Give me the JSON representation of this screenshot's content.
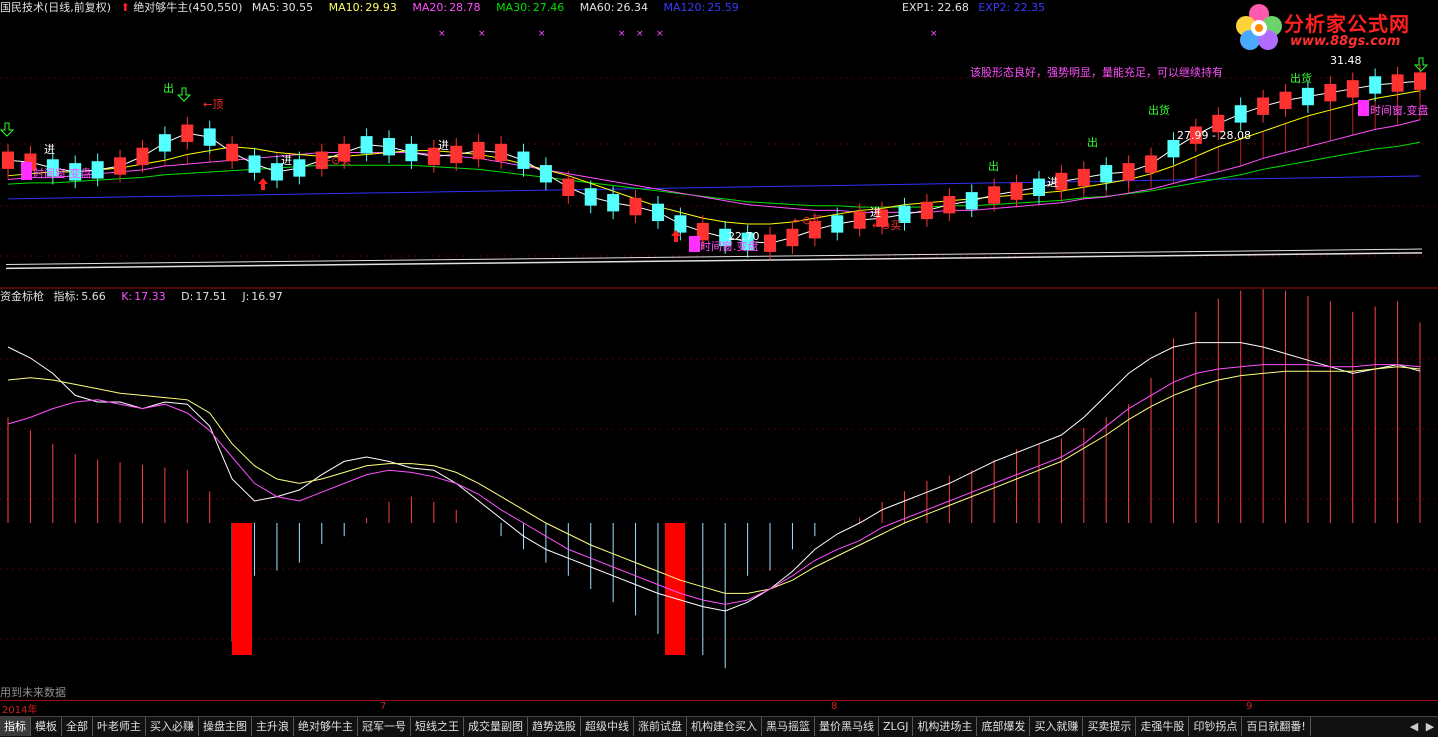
{
  "header": {
    "stock": "国民技术(日线,前复权)",
    "indicator_name": "绝对够牛主(450,550)",
    "ma5_label": "MA5:",
    "ma5": "30.55",
    "ma10_label": "MA10:",
    "ma10": "29.93",
    "ma20_label": "MA20:",
    "ma20": "28.78",
    "ma30_label": "MA30:",
    "ma30": "27.46",
    "ma60_label": "MA60:",
    "ma60": "26.34",
    "ma120_label": "MA120:",
    "ma120": "25.59",
    "exp1_label": "EXP1:",
    "exp1": "22.68",
    "exp2_label": "EXP2:",
    "exp2": "22.35"
  },
  "logo": {
    "brand": "分析家公式网",
    "url": "www.88gs.com"
  },
  "main_annotations": {
    "comment": "该股形态良好，强势明显，量能充足，可以继续持有",
    "top": "←顶",
    "jin": "进",
    "chu": "出",
    "chu_huo": "出货",
    "buy": "←⊙买",
    "price_low": "22.70",
    "price_high": "31.48",
    "range": "27.99 - 28.08",
    "time_window": "时间窗.变盘"
  },
  "sub_header": {
    "title": "资金标枪",
    "indicator_label": "指标:",
    "indicator": "5.66",
    "k_label": "K:",
    "k": "17.33",
    "d_label": "D:",
    "d": "17.51",
    "j_label": "J:",
    "j": "16.97"
  },
  "note": "用到未来数据",
  "date_axis": {
    "year": "2014年",
    "m7": "7",
    "m8": "8",
    "m9": "9"
  },
  "tabs": [
    "指标",
    "模板",
    "全部",
    "叶老师主",
    "买入必赚",
    "操盘主图",
    "主升浪",
    "绝对够牛主",
    "冠军一号",
    "短线之王",
    "成交量副图",
    "趋势选股",
    "超级中线",
    "涨前试盘",
    "机构建仓买入",
    "黑马摇篮",
    "量价黑马线",
    "ZLGJ",
    "机构进场主",
    "底部爆发",
    "买入就赚",
    "买卖提示",
    "走强牛股",
    "印钞拐点",
    "百日就翻番!"
  ],
  "tab_arrows": [
    "◀",
    "▶"
  ],
  "colors": {
    "up": "#ff3232",
    "down": "#54ffff",
    "ma5": "#ffffff",
    "ma10": "#ffff00",
    "ma20": "#ff50ff",
    "ma30": "#00e000",
    "ma60": "#cccccc",
    "ma120": "#3030ff",
    "k": "#ffffff",
    "d": "#ffff80",
    "j": "#ff50ff",
    "signal": "#ff00ff"
  },
  "chart_data": [
    {
      "type": "candlestick",
      "series": [
        {
          "name": "MA5",
          "values": [
            27.6,
            27.5,
            27.2,
            27.0,
            27.1,
            27.3,
            27.8,
            28.5,
            29.0,
            28.8,
            28.0,
            27.4,
            27.0,
            27.2,
            27.6,
            28.0,
            28.4,
            28.3,
            28.0,
            27.8,
            27.9,
            28.1,
            28.0,
            27.6,
            26.9,
            26.2,
            25.7,
            25.4,
            25.2,
            24.9,
            24.3,
            23.9,
            23.6,
            23.4,
            23.3,
            23.6,
            24.0,
            24.3,
            24.5,
            24.6,
            24.8,
            25.0,
            25.3,
            25.5,
            25.8,
            26.0,
            26.2,
            26.5,
            26.7,
            26.9,
            27.0,
            27.4,
            28.2,
            28.9,
            29.5,
            30.0,
            30.4,
            30.7,
            30.9,
            31.1,
            31.3,
            31.5,
            31.6,
            31.7
          ]
        },
        {
          "name": "MA10",
          "values": [
            26.8,
            26.9,
            27.0,
            27.0,
            27.1,
            27.2,
            27.4,
            27.6,
            27.9,
            28.1,
            28.3,
            28.2,
            28.0,
            27.9,
            27.8,
            27.8,
            27.9,
            28.0,
            28.1,
            28.1,
            28.0,
            27.9,
            27.7,
            27.4,
            27.1,
            26.8,
            26.4,
            26.0,
            25.6,
            25.2,
            24.9,
            24.6,
            24.4,
            24.3,
            24.3,
            24.4,
            24.6,
            24.8,
            25.0,
            25.1,
            25.3,
            25.4,
            25.5,
            25.6,
            25.7,
            25.8,
            25.9,
            26.0,
            26.2,
            26.4,
            26.6,
            26.9,
            27.3,
            27.8,
            28.3,
            28.7,
            29.1,
            29.5,
            29.9,
            30.2,
            30.5,
            30.8,
            31.0,
            31.2
          ]
        },
        {
          "name": "MA20",
          "values": [
            26.6,
            26.7,
            26.7,
            26.8,
            26.9,
            27.0,
            27.1,
            27.3,
            27.4,
            27.5,
            27.6,
            27.7,
            27.8,
            27.9,
            28.0,
            28.0,
            28.0,
            28.0,
            28.0,
            27.9,
            27.8,
            27.7,
            27.5,
            27.3,
            27.1,
            26.9,
            26.7,
            26.5,
            26.3,
            26.1,
            25.9,
            25.7,
            25.5,
            25.3,
            25.2,
            25.1,
            25.0,
            25.0,
            24.9,
            24.9,
            24.9,
            24.9,
            25.0,
            25.0,
            25.1,
            25.2,
            25.3,
            25.4,
            25.6,
            25.7,
            25.9,
            26.1,
            26.4,
            26.7,
            27.0,
            27.3,
            27.7,
            28.0,
            28.3,
            28.6,
            28.9,
            29.2,
            29.4,
            29.7
          ]
        }
      ]
    },
    {
      "type": "line",
      "series": [
        {
          "name": "K",
          "values": [
            80,
            75,
            68,
            58,
            55,
            55,
            52,
            55,
            54,
            44,
            20,
            10,
            12,
            15,
            22,
            28,
            30,
            28,
            25,
            24,
            18,
            10,
            2,
            -6,
            -12,
            -16,
            -20,
            -24,
            -28,
            -32,
            -35,
            -38,
            -40,
            -36,
            -30,
            -22,
            -12,
            -5,
            0,
            6,
            10,
            14,
            18,
            23,
            28,
            32,
            36,
            40,
            48,
            58,
            68,
            75,
            80,
            82,
            82,
            82,
            80,
            77,
            74,
            71,
            68,
            70,
            72,
            69
          ]
        },
        {
          "name": "D",
          "values": [
            65,
            66,
            65,
            63,
            61,
            59,
            58,
            57,
            56,
            50,
            36,
            26,
            20,
            18,
            20,
            23,
            26,
            27,
            27,
            26,
            23,
            18,
            12,
            6,
            0,
            -5,
            -10,
            -14,
            -18,
            -22,
            -26,
            -29,
            -32,
            -32,
            -30,
            -26,
            -20,
            -15,
            -10,
            -5,
            0,
            4,
            8,
            12,
            16,
            20,
            24,
            28,
            34,
            40,
            47,
            53,
            58,
            62,
            65,
            67,
            68,
            69,
            69,
            69,
            69,
            70,
            71,
            70
          ]
        },
        {
          "name": "J",
          "values": [
            45,
            48,
            52,
            55,
            56,
            54,
            52,
            54,
            50,
            42,
            30,
            18,
            12,
            10,
            14,
            18,
            22,
            24,
            23,
            21,
            18,
            13,
            6,
            0,
            -6,
            -12,
            -16,
            -20,
            -24,
            -28,
            -32,
            -35,
            -37,
            -35,
            -30,
            -24,
            -17,
            -12,
            -8,
            -2,
            2,
            6,
            10,
            14,
            18,
            22,
            26,
            30,
            36,
            44,
            52,
            58,
            64,
            68,
            70,
            71,
            72,
            72,
            72,
            71,
            71,
            72,
            72,
            71
          ]
        },
        {
          "name": "指标",
          "values": [
            40,
            35,
            30,
            26,
            24,
            23,
            22,
            21,
            20,
            12,
            -45,
            -20,
            -18,
            -15,
            -8,
            -5,
            2,
            8,
            10,
            8,
            5,
            0,
            -5,
            -10,
            -15,
            -20,
            -25,
            -30,
            -35,
            -42,
            -45,
            -50,
            -55,
            -20,
            -18,
            -10,
            -5,
            0,
            2,
            8,
            12,
            16,
            18,
            20,
            24,
            28,
            30,
            32,
            36,
            40,
            45,
            55,
            70,
            80,
            85,
            88,
            90,
            88,
            86,
            84,
            80,
            82,
            84,
            76
          ]
        }
      ]
    }
  ]
}
